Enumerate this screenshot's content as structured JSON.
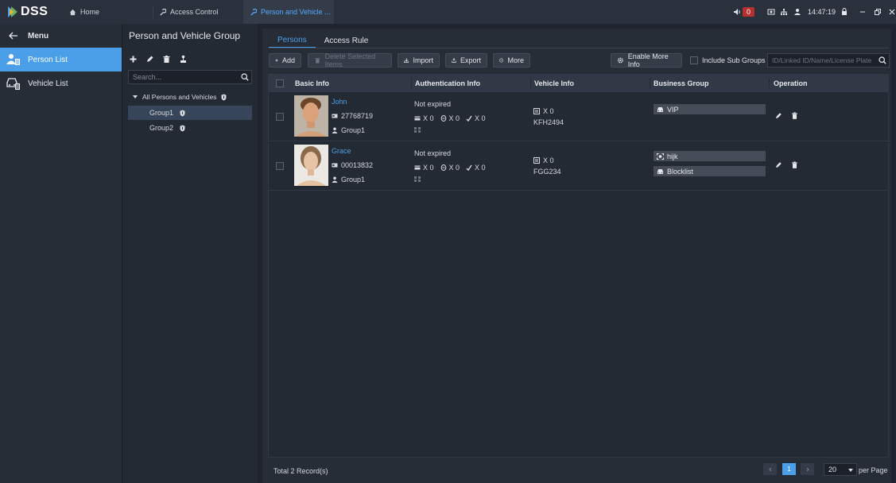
{
  "app": {
    "logo": "DSS",
    "brand_color": "#4a9fe8"
  },
  "topbar": {
    "tabs": [
      {
        "label": "Home",
        "icon": "home-icon"
      },
      {
        "label": "Access Control",
        "icon": "wrench-icon"
      },
      {
        "label": "Person and Vehicle ...",
        "icon": "wrench-icon",
        "active": true
      }
    ],
    "alarm_count": "0",
    "time": "14:47:19"
  },
  "menu": {
    "title": "Menu",
    "items": [
      {
        "label": "Person List",
        "icon": "person-list-icon",
        "active": true
      },
      {
        "label": "Vehicle List",
        "icon": "vehicle-list-icon"
      }
    ]
  },
  "groups": {
    "title": "Person and Vehicle Group",
    "search_placeholder": "Search...",
    "root": "All Persons and Vehicles",
    "items": [
      {
        "label": "Group1",
        "selected": true
      },
      {
        "label": "Group2"
      }
    ]
  },
  "main": {
    "tabs": [
      "Persons",
      "Access Rule"
    ],
    "toolbar": {
      "add": "Add",
      "delete_selected": "Delete Selected Items",
      "import": "Import",
      "export": "Export",
      "more": "More",
      "enable_more_info": "Enable More Info",
      "include_sub_groups": "Include Sub Groups",
      "search_placeholder": "ID/Linked ID/Name/License Plate"
    },
    "columns": [
      "Basic Info",
      "Authentication Info",
      "Vehicle Info",
      "Business Group",
      "Operation"
    ],
    "rows": [
      {
        "name": "John",
        "id": "27768719",
        "group": "Group1",
        "auth_status": "Not expired",
        "cards": "X 0",
        "faces": "X 0",
        "fingerprints": "X 0",
        "vehicles": "X 0",
        "plate": "KFH2494",
        "business_groups": [
          "VIP"
        ]
      },
      {
        "name": "Grace",
        "id": "00013832",
        "group": "Group1",
        "auth_status": "Not expired",
        "cards": "X 0",
        "faces": "X 0",
        "fingerprints": "X 0",
        "vehicles": "X 0",
        "plate": "FGG234",
        "business_groups": [
          "hijk",
          "Blocklist"
        ]
      }
    ],
    "footer": {
      "total": "Total 2 Record(s)",
      "current_page": "1",
      "page_size": "20",
      "per_page": "per Page"
    }
  }
}
